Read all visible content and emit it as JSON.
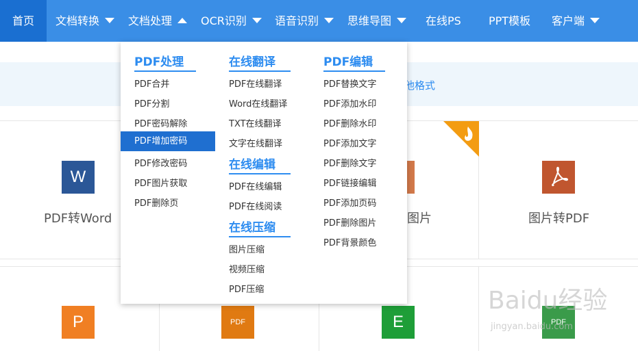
{
  "nav": {
    "items": [
      {
        "label": "首页",
        "caret": ""
      },
      {
        "label": "文档转换",
        "caret": "down"
      },
      {
        "label": "文档处理",
        "caret": "up"
      },
      {
        "label": "OCR识别",
        "caret": "down"
      },
      {
        "label": "语音识别",
        "caret": "down"
      },
      {
        "label": "思维导图",
        "caret": "down"
      },
      {
        "label": "在线PS",
        "caret": ""
      },
      {
        "label": "PPT模板",
        "caret": ""
      },
      {
        "label": "客户端",
        "caret": "down"
      }
    ]
  },
  "banner": {
    "text": "他格式"
  },
  "tools": [
    {
      "label": "PDF转Word",
      "icon_char": "W",
      "color": "#2b5797"
    },
    {
      "label": "图片",
      "icon_char": "",
      "color": "#d2794a"
    },
    {
      "label": "图片转PDF",
      "icon_char": "",
      "color": "#c0562f"
    },
    {
      "label": "",
      "icon_char": "P",
      "color": "#f07f23"
    },
    {
      "label": "",
      "icon_char": "PDF",
      "color": "#e07a12"
    },
    {
      "label": "",
      "icon_char": "E",
      "color": "#1e9e38"
    },
    {
      "label": "",
      "icon_char": "PDF",
      "color": "#3a9b4a"
    }
  ],
  "dropdown": {
    "columns": [
      {
        "groups": [
          {
            "title": "PDF处理",
            "links": [
              "PDF合并",
              "PDF分割",
              "PDF密码解除",
              "PDF增加密码",
              "PDF修改密码",
              "PDF图片获取",
              "PDF删除页"
            ]
          }
        ]
      },
      {
        "groups": [
          {
            "title": "在线翻译",
            "links": [
              "PDF在线翻译",
              "Word在线翻译",
              "TXT在线翻译",
              "文字在线翻译"
            ]
          },
          {
            "title": "在线编辑",
            "links": [
              "PDF在线编辑",
              "PDF在线阅读"
            ]
          },
          {
            "title": "在线压缩",
            "links": [
              "图片压缩",
              "视频压缩",
              "PDF压缩"
            ]
          }
        ]
      },
      {
        "groups": [
          {
            "title": "PDF编辑",
            "links": [
              "PDF替换文字",
              "PDF添加水印",
              "PDF删除水印",
              "PDF添加文字",
              "PDF删除文字",
              "PDF链接编辑",
              "PDF添加页码",
              "PDF删除图片",
              "PDF背景颜色"
            ]
          }
        ]
      }
    ],
    "selected": "PDF增加密码"
  },
  "watermark": {
    "text": "Baidu经验",
    "sub": "jingyan.baidu.com"
  },
  "colors": {
    "nav_bg": "#3a8ee6",
    "nav_active": "#1a6fd1",
    "accent": "#2d8cf0"
  }
}
